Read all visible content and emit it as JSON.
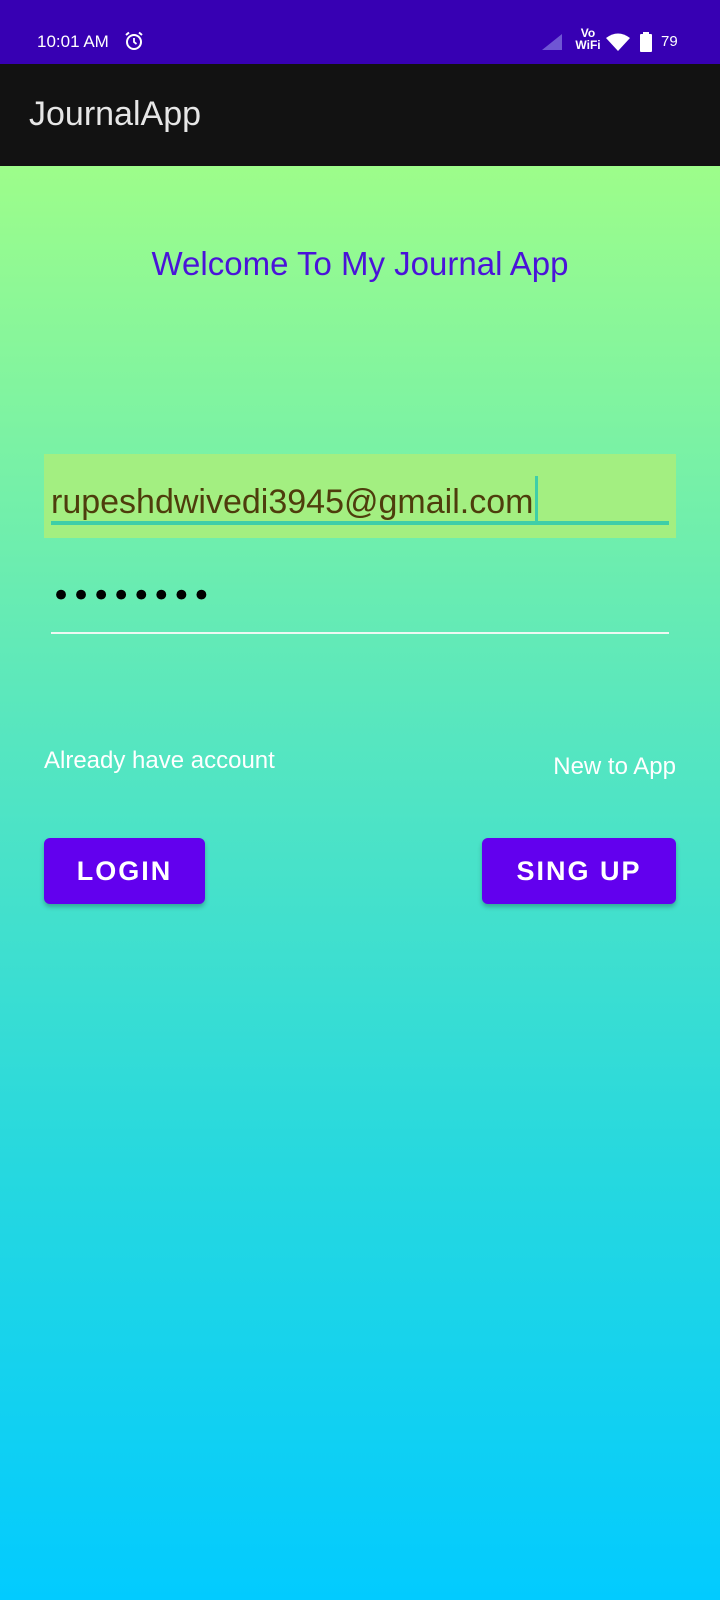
{
  "status_bar": {
    "time": "10:01 AM",
    "network_label": "Vo WiFi",
    "battery": "79",
    "icons": [
      "alarm-icon",
      "signal-icon",
      "wifi-icon",
      "battery-icon"
    ],
    "color": "#3700B3"
  },
  "app_bar": {
    "title": "JournalApp",
    "color": "#121212"
  },
  "main": {
    "welcome": "Welcome To My Journal App",
    "email_value": "rupeshdwivedi3945@gmail.com",
    "password_value": "••••••••",
    "already_account_label": "Already have account",
    "new_to_app_label": "New to App",
    "login_button": "LOGIN",
    "signup_button": "SING UP"
  },
  "colors": {
    "accent": "#6200EE",
    "welcome_text": "#4a13d9",
    "gradient_top": "#9dfd8a",
    "gradient_bottom": "#02cbff"
  }
}
